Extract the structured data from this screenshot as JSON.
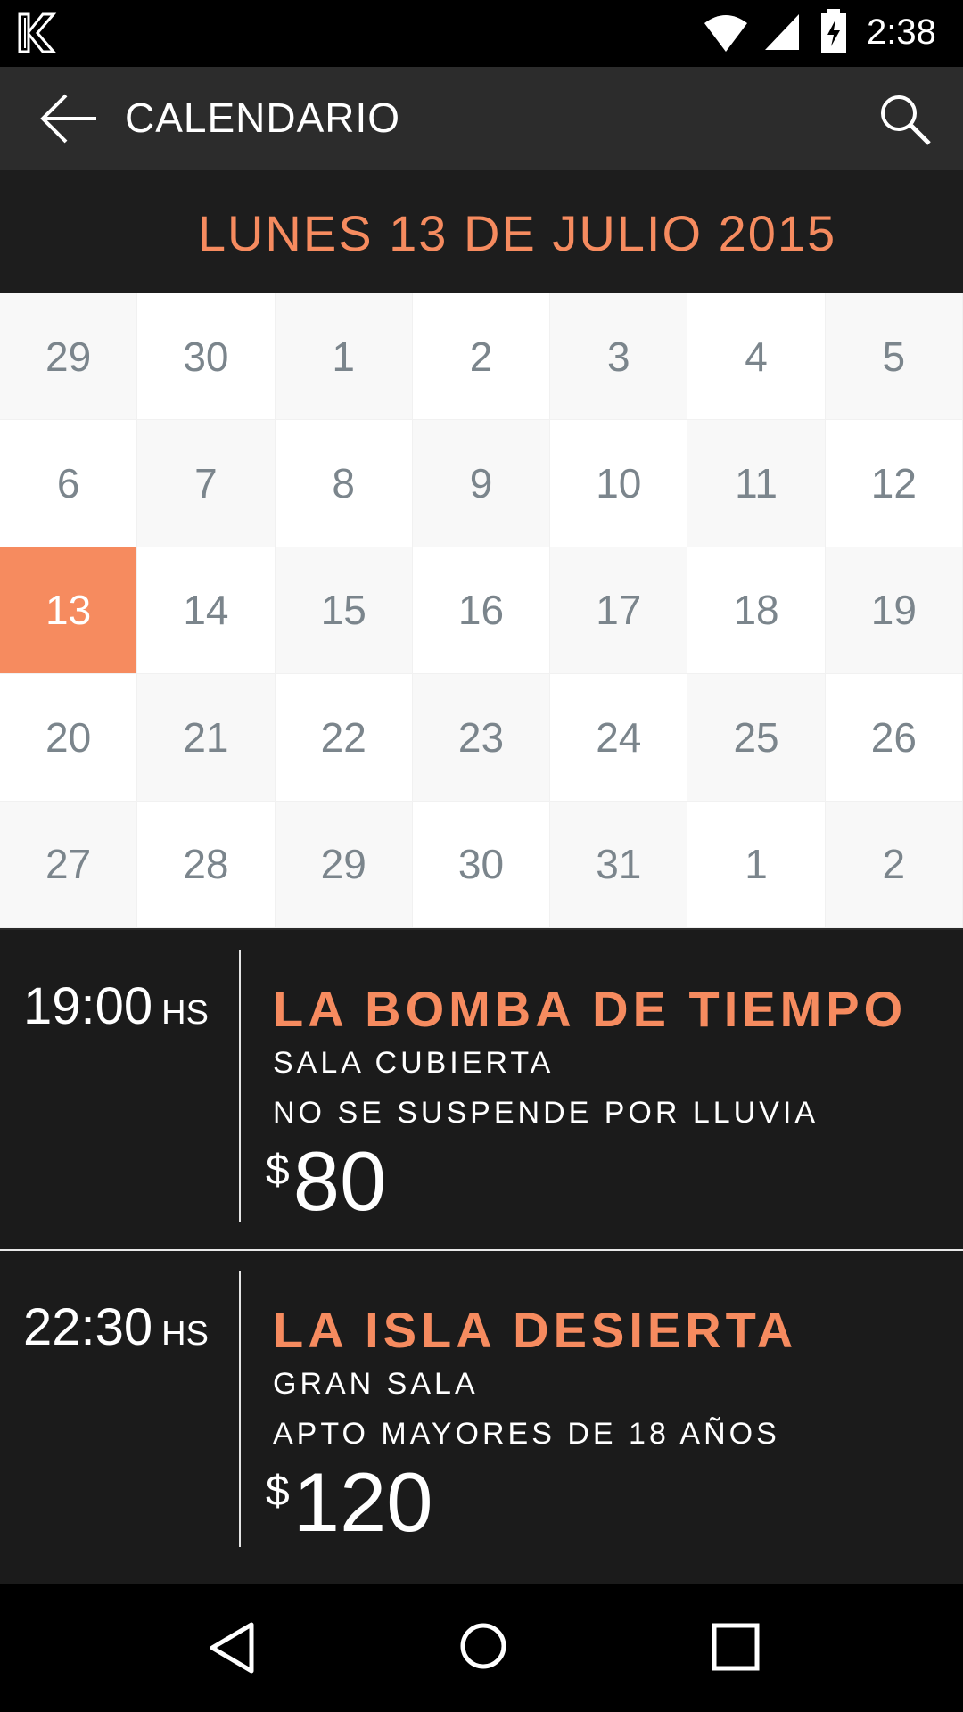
{
  "status_bar": {
    "time": "2:38"
  },
  "app_bar": {
    "title": "CALENDARIO"
  },
  "date_header": "LUNES 13 DE JULIO 2015",
  "calendar": {
    "days": [
      "29",
      "30",
      "1",
      "2",
      "3",
      "4",
      "5",
      "6",
      "7",
      "8",
      "9",
      "10",
      "11",
      "12",
      "13",
      "14",
      "15",
      "16",
      "17",
      "18",
      "19",
      "20",
      "21",
      "22",
      "23",
      "24",
      "25",
      "26",
      "27",
      "28",
      "29",
      "30",
      "31",
      "1",
      "2"
    ],
    "selected_day": "13"
  },
  "events": [
    {
      "time": "19:00",
      "time_unit": "HS",
      "name": "LA BOMBA DE TIEMPO",
      "venue": "SALA CUBIERTA",
      "note": "NO SE SUSPENDE POR LLUVIA",
      "currency": "$",
      "price": "80"
    },
    {
      "time": "22:30",
      "time_unit": "HS",
      "name": "LA ISLA DESIERTA",
      "venue": "GRAN SALA",
      "note": "APTO MAYORES DE 18 AÑOS",
      "currency": "$",
      "price": "120"
    }
  ],
  "colors": {
    "accent": "#f68b5f",
    "background_dark": "#1b1b1b",
    "app_bar": "#2c2c2c"
  }
}
